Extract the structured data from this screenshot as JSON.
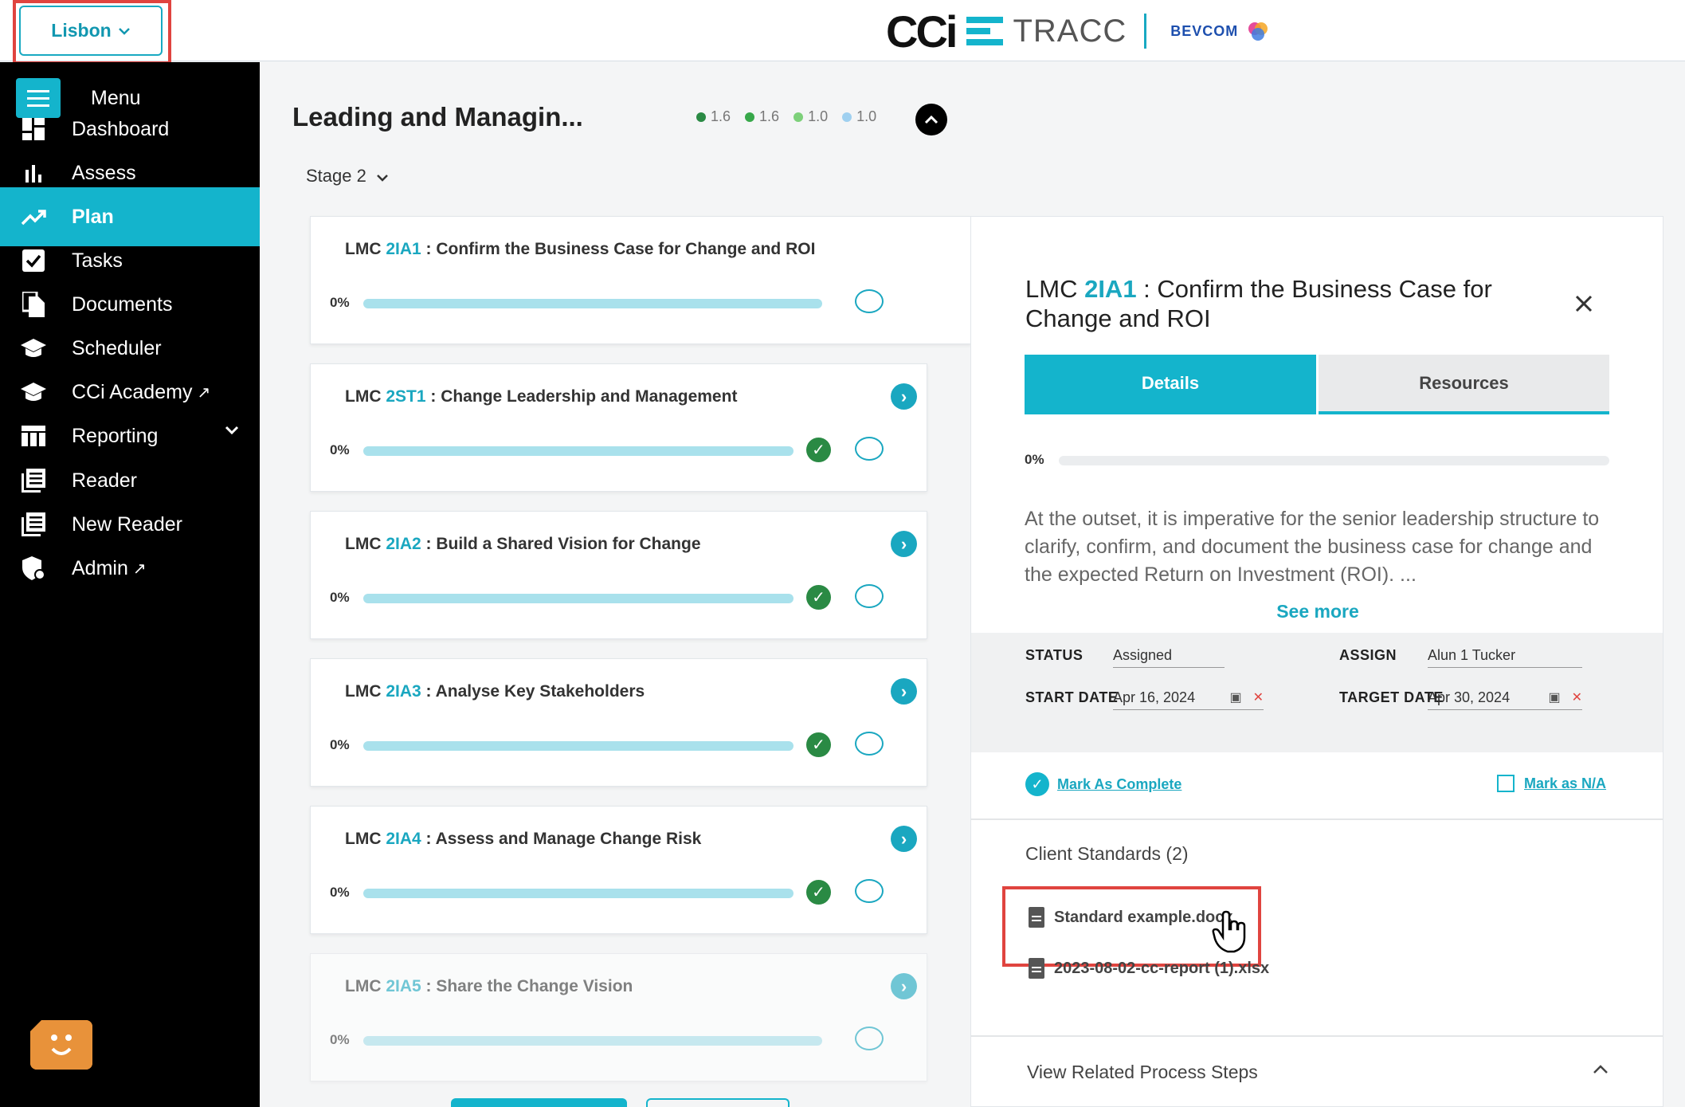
{
  "location": {
    "label": "Lisbon"
  },
  "brand": {
    "logo": "CCi",
    "product": "TRACC",
    "client": "BEVCOM"
  },
  "sidebar": {
    "menu_label": "Menu",
    "items": [
      {
        "label": "Dashboard",
        "icon": "dashboard-icon"
      },
      {
        "label": "Assess",
        "icon": "bar-chart-icon"
      },
      {
        "label": "Plan",
        "icon": "trend-icon",
        "active": true
      },
      {
        "label": "Tasks",
        "icon": "checkbox-icon"
      },
      {
        "label": "Documents",
        "icon": "documents-icon"
      },
      {
        "label": "Scheduler",
        "icon": "graduation-cap-icon"
      },
      {
        "label": "CCi Academy",
        "icon": "graduation-cap-icon",
        "external": true
      },
      {
        "label": "Reporting",
        "icon": "table-icon",
        "expandable": true
      },
      {
        "label": "Reader",
        "icon": "reader-icon"
      },
      {
        "label": "New Reader",
        "icon": "reader-icon"
      },
      {
        "label": "Admin",
        "icon": "shield-icon",
        "external": true
      }
    ]
  },
  "header": {
    "title": "Leading and Managin...",
    "scores": [
      {
        "value": "1.6",
        "color": "#2a8a44"
      },
      {
        "value": "1.6",
        "color": "#37a84a"
      },
      {
        "value": "1.0",
        "color": "#7dd07a"
      },
      {
        "value": "1.0",
        "color": "#9fd0f0"
      }
    ],
    "stage": "Stage 2"
  },
  "tasks": [
    {
      "prefix": "LMC ",
      "code": "2IA1",
      "title": " : Confirm the Business Case for Change and ROI",
      "pct": "0%"
    },
    {
      "prefix": "LMC ",
      "code": "2ST1",
      "title": " : Change Leadership and Management",
      "pct": "0%"
    },
    {
      "prefix": "LMC ",
      "code": "2IA2",
      "title": " : Build a Shared Vision for Change",
      "pct": "0%"
    },
    {
      "prefix": "LMC ",
      "code": "2IA3",
      "title": " : Analyse Key Stakeholders",
      "pct": "0%"
    },
    {
      "prefix": "LMC ",
      "code": "2IA4",
      "title": " : Assess and Manage Change Risk",
      "pct": "0%"
    },
    {
      "prefix": "LMC ",
      "code": "2IA5",
      "title": " : Share the Change Vision",
      "pct": "0%"
    }
  ],
  "detail": {
    "prefix": "LMC ",
    "code": "2IA1",
    "title": " : Confirm the Business Case for Change and ROI",
    "tabs": {
      "details": "Details",
      "resources": "Resources"
    },
    "progress": 0,
    "pct": "0%",
    "description": "At the outset, it is imperative for the senior leadership structure to clarify, confirm, and document the business case for change and the expected Return on Investment (ROI). ...",
    "see_more": "See more",
    "status_label": "STATUS",
    "status_value": "Assigned",
    "assign_label": "ASSIGN",
    "assign_value": "Alun 1 Tucker",
    "start_label": "START DATE",
    "start_value": "Apr 16, 2024",
    "target_label": "TARGET DATE",
    "target_value": "Apr 30, 2024",
    "mark_complete": "Mark As Complete",
    "mark_na": "Mark as N/A",
    "client_standards_title": "Client Standards (2)",
    "files": [
      "Standard example.docx",
      "2023-08-02-cc-report (1).xlsx"
    ],
    "related_steps": "View Related Process Steps"
  }
}
